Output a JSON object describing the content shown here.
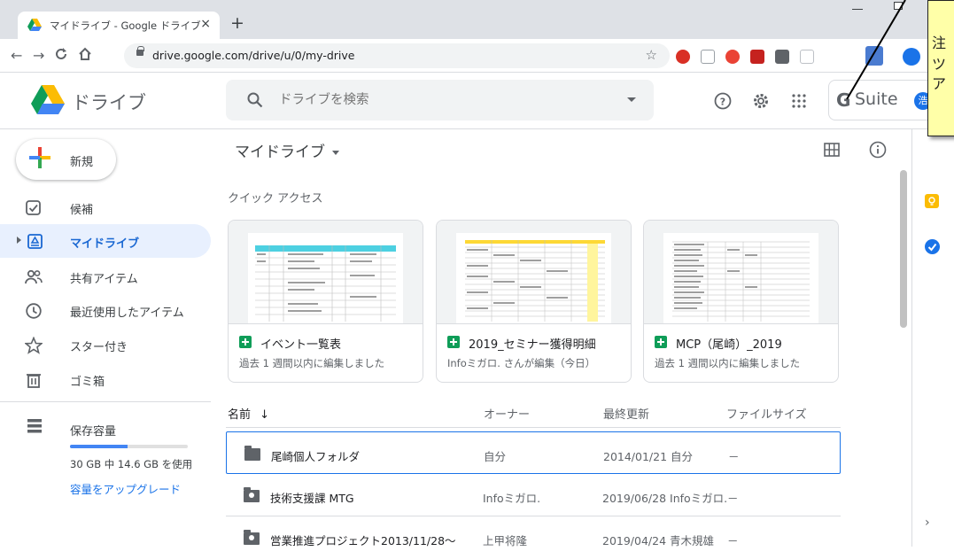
{
  "browser": {
    "tab_title": "マイドライブ - Google ドライブ",
    "tab_close": "×",
    "new_tab": "+",
    "url": "drive.google.com/drive/u/0/my-drive"
  },
  "app": {
    "logo_text": "ドライブ",
    "search_placeholder": "ドライブを検索",
    "gsuite_g": "G",
    "gsuite_label": "Suite",
    "avatar_initial": "浩"
  },
  "note": {
    "lines": [
      "注",
      "ツ",
      "ア"
    ]
  },
  "sidebar": {
    "new_label": "新規",
    "items": [
      {
        "label": "候補",
        "icon": "check-box-icon"
      },
      {
        "label": "マイドライブ",
        "icon": "my-drive-icon",
        "active": true
      },
      {
        "label": "共有アイテム",
        "icon": "shared-people-icon"
      },
      {
        "label": "最近使用したアイテム",
        "icon": "clock-icon"
      },
      {
        "label": "スター付き",
        "icon": "star-icon"
      },
      {
        "label": "ゴミ箱",
        "icon": "trash-icon"
      }
    ],
    "storage": {
      "label": "保存容量",
      "usage_text": "30 GB 中 14.6 GB を使用",
      "used_fraction": 0.487,
      "upgrade_link": "容量をアップグレード"
    }
  },
  "main": {
    "breadcrumb": "マイドライブ",
    "quick_access_label": "クイック アクセス",
    "quick_access": [
      {
        "name": "イベント一覧表",
        "subtitle": "過去 1 週間以内に編集しました"
      },
      {
        "name": "2019_セミナー獲得明細",
        "subtitle": "Infoミガロ. さんが編集（今日）"
      },
      {
        "name": "MCP（尾崎）_2019",
        "subtitle": "過去 1 週間以内に編集しました"
      }
    ],
    "columns": {
      "name": "名前",
      "sort_arrow": "↓",
      "owner": "オーナー",
      "modified": "最終更新",
      "size": "ファイルサイズ"
    },
    "files": [
      {
        "name": "尾崎個人フォルダ",
        "owner": "自分",
        "modified": "2014/01/21 自分",
        "size": "－",
        "shared": false,
        "selected": true
      },
      {
        "name": "技術支援課 MTG",
        "owner": "Infoミガロ.",
        "modified": "2019/06/28 Infoミガロ.",
        "size": "－",
        "shared": true,
        "selected": false
      },
      {
        "name": "営業推進プロジェクト2013/11/28～",
        "owner": "上甲将隆",
        "modified": "2019/04/24 青木規雄",
        "size": "－",
        "shared": true,
        "selected": false
      }
    ]
  },
  "colors": {
    "accent": "#1a73e8",
    "active_bg": "#e8f0fe",
    "sheets_green": "#0f9d58",
    "note_yellow": "#ffffa8"
  }
}
